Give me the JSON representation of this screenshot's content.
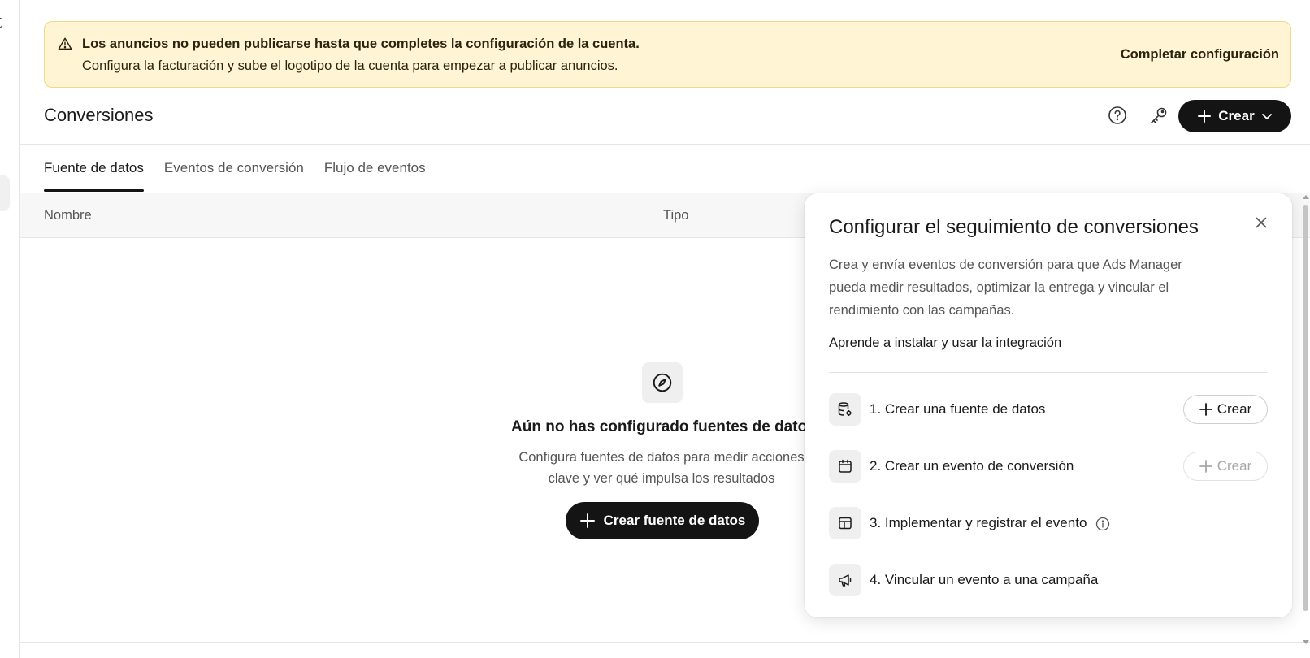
{
  "banner": {
    "title": "Los anuncios no pueden publicarse hasta que completes la configuración de la cuenta.",
    "subtitle": "Configura la facturación y sube el logotipo de la cuenta para empezar a publicar anuncios.",
    "action": "Completar configuración",
    "icon": "warning-icon",
    "bg_color": "#fff5d4"
  },
  "header": {
    "title": "Conversiones",
    "help_icon": "help-circle-icon",
    "key_icon": "key-icon",
    "create_label": "Crear"
  },
  "tabs": [
    {
      "label": "Fuente de datos",
      "active": true
    },
    {
      "label": "Eventos de conversión",
      "active": false
    },
    {
      "label": "Flujo de eventos",
      "active": false
    }
  ],
  "table": {
    "columns": [
      "Nombre",
      "Tipo"
    ]
  },
  "empty_state": {
    "icon": "compass-icon",
    "title": "Aún no has configurado fuentes de datos",
    "description": "Configura fuentes de datos para medir acciones clave y ver qué impulsa los resultados",
    "button_label": "Crear fuente de datos"
  },
  "setup_panel": {
    "title": "Configurar el seguimiento de conversiones",
    "description": "Crea y envía eventos de conversión para que Ads Manager pueda medir resultados, optimizar la entrega y vincular el rendimiento con las campañas.",
    "link": "Aprende a instalar y usar la integración",
    "steps": [
      {
        "label": "1. Crear una fuente de datos",
        "icon": "database-settings-icon",
        "button": "Crear",
        "button_enabled": true
      },
      {
        "label": "2. Crear un evento de conversión",
        "icon": "calendar-icon",
        "button": "Crear",
        "button_enabled": false
      },
      {
        "label": "3. Implementar y registrar el evento",
        "icon": "layout-icon",
        "has_info": true
      },
      {
        "label": "4. Vincular un evento a una campaña",
        "icon": "megaphone-icon"
      }
    ]
  },
  "colors": {
    "primary_button": "#141414",
    "banner_border": "#f0d885"
  }
}
